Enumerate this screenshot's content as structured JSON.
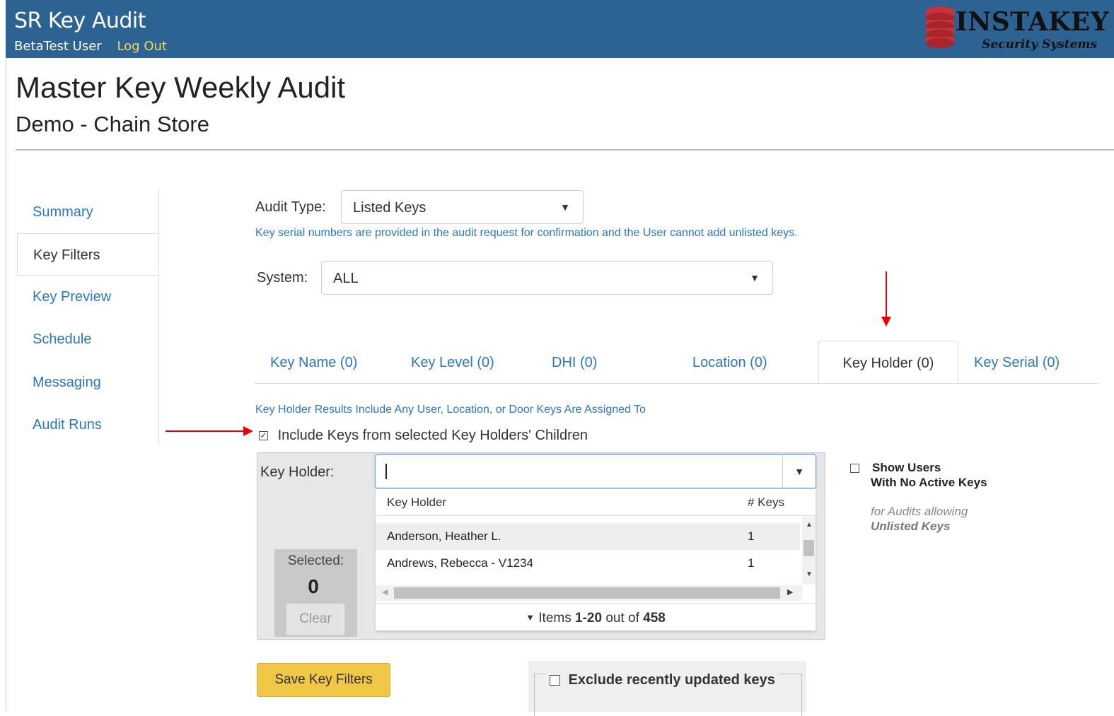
{
  "header": {
    "app_title": "SR Key Audit",
    "user_name": "BetaTest User",
    "logout_label": "Log Out",
    "logo_word": "INSTAKEY",
    "logo_sub": "Security Systems",
    "bg_color": "#2c6393"
  },
  "page": {
    "title": "Master Key Weekly Audit",
    "subtitle": "Demo - Chain Store"
  },
  "sidebar": {
    "items": [
      {
        "label": "Summary"
      },
      {
        "label": "Key Filters",
        "active": true
      },
      {
        "label": "Key Preview"
      },
      {
        "label": "Schedule"
      },
      {
        "label": "Messaging"
      },
      {
        "label": "Audit Runs"
      }
    ]
  },
  "audit_type": {
    "label": "Audit Type:",
    "value": "Listed Keys",
    "hint": "Key serial numbers are provided in the audit request for confirmation and the User cannot add unlisted keys."
  },
  "system": {
    "label": "System:",
    "value": "ALL"
  },
  "tabs": [
    {
      "label": "Key Name (0)"
    },
    {
      "label": "Key Level (0)"
    },
    {
      "label": "DHI (0)"
    },
    {
      "label": "Location (0)"
    },
    {
      "label": "Key Holder (0)",
      "active": true
    },
    {
      "label": "Key Serial (0)"
    }
  ],
  "key_holder": {
    "info": "Key Holder Results Include Any User, Location, or Door Keys Are Assigned To",
    "include_children_label": "Include Keys from selected Key Holders' Children",
    "include_children_checked": true,
    "field_label": "Key Holder:",
    "input_value": "",
    "dropdown": {
      "col_name": "Key Holder",
      "col_keys": "# Keys",
      "rows": [
        {
          "name": "Anderson, Heather L.",
          "keys": "1"
        },
        {
          "name": "Andrews, Rebecca - V1234",
          "keys": "1"
        }
      ],
      "pager_prefix": "Items",
      "pager_range": "1-20",
      "pager_mid": "out of",
      "pager_total": "458"
    },
    "selected_label": "Selected:",
    "selected_count": "0",
    "clear_label": "Clear"
  },
  "show_users": {
    "line1": "Show Users",
    "line2": "With No Active Keys",
    "note1": "for Audits allowing",
    "note2": "Unlisted Keys",
    "checked": false
  },
  "save_button": "Save Key Filters",
  "exclude": {
    "label": "Exclude recently updated keys",
    "checked": false
  }
}
